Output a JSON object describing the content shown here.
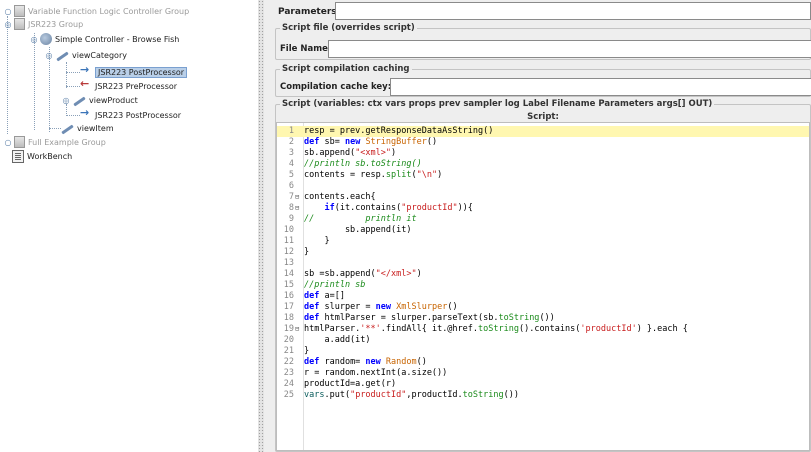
{
  "tree": {
    "items": [
      {
        "label": "Variable Function Logic Controller Group",
        "disabled": true
      },
      {
        "label": "JSR223 Group",
        "disabled": true
      },
      {
        "label": "Simple Controller - Browse Fish"
      },
      {
        "label": "viewCategory"
      },
      {
        "label": "JSR223 PostProcessor",
        "selected": true
      },
      {
        "label": "JSR223 PreProcessor"
      },
      {
        "label": "viewProduct"
      },
      {
        "label": "JSR223 PostProcessor"
      },
      {
        "label": "viewItem"
      },
      {
        "label": "Full Example Group",
        "disabled": true
      },
      {
        "label": "WorkBench"
      }
    ]
  },
  "form": {
    "parameters_label": "Parameters:",
    "script_file_title": "Script file (overrides script)",
    "file_name_label": "File Name:",
    "caching_title": "Script compilation caching",
    "cache_key_label": "Compilation cache key:",
    "script_group_title": "Script (variables: ctx vars props prev sampler log Label Filename Parameters args[] OUT)",
    "script_header": "Script:"
  },
  "script": {
    "lines": [
      {
        "n": "1",
        "text": "resp = prev.getResponseDataAsString()"
      },
      {
        "n": "2",
        "text": "def sb= new StringBuffer()"
      },
      {
        "n": "3",
        "text": "sb.append(\"<xml>\")"
      },
      {
        "n": "4",
        "text": "//println sb.toString()"
      },
      {
        "n": "5",
        "text": "contents = resp.split(\"\\n\")"
      },
      {
        "n": "6",
        "text": ""
      },
      {
        "n": "7",
        "text": "contents.each{"
      },
      {
        "n": "8",
        "text": "    if(it.contains(\"productId\")){"
      },
      {
        "n": "9",
        "text": "//          println it"
      },
      {
        "n": "10",
        "text": "        sb.append(it)"
      },
      {
        "n": "11",
        "text": "    }"
      },
      {
        "n": "12",
        "text": "}"
      },
      {
        "n": "13",
        "text": ""
      },
      {
        "n": "14",
        "text": "sb =sb.append(\"</xml>\")"
      },
      {
        "n": "15",
        "text": "//println sb"
      },
      {
        "n": "16",
        "text": "def a=[]"
      },
      {
        "n": "17",
        "text": "def slurper = new XmlSlurper()"
      },
      {
        "n": "18",
        "text": "def htmlParser = slurper.parseText(sb.toString())"
      },
      {
        "n": "19",
        "text": "htmlParser.'**'.findAll{ it.@href.toString().contains('productId') }.each {"
      },
      {
        "n": "20",
        "text": "    a.add(it)"
      },
      {
        "n": "21",
        "text": "}"
      },
      {
        "n": "22",
        "text": "def random= new Random()"
      },
      {
        "n": "23",
        "text": "r = random.nextInt(a.size())"
      },
      {
        "n": "24",
        "text": "productId=a.get(r)"
      },
      {
        "n": "25",
        "text": "vars.put(\"productId\",productId.toString())"
      }
    ]
  },
  "icons": [
    "switch-icon",
    "controller-icon",
    "simple-controller-icon",
    "sampler-icon",
    "postprocessor-icon",
    "preprocessor-icon",
    "workbench-icon"
  ]
}
